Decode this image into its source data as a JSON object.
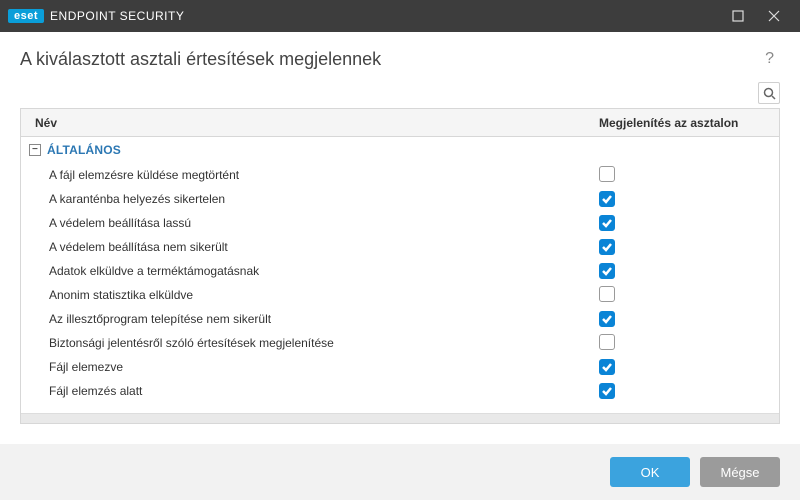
{
  "titlebar": {
    "brand": "eset",
    "product": "ENDPOINT SECURITY"
  },
  "page": {
    "title": "A kiválasztott asztali értesítések megjelennek",
    "help": "?"
  },
  "table": {
    "cols": {
      "name": "Név",
      "show": "Megjelenítés az asztalon"
    },
    "group": "ÁLTALÁNOS",
    "rows": [
      {
        "label": "A fájl elemzésre küldése megtörtént",
        "checked": false
      },
      {
        "label": "A karanténba helyezés sikertelen",
        "checked": true
      },
      {
        "label": "A védelem beállítása lassú",
        "checked": true
      },
      {
        "label": "A védelem beállítása nem sikerült",
        "checked": true
      },
      {
        "label": "Adatok elküldve a terméktámogatásnak",
        "checked": true
      },
      {
        "label": "Anonim statisztika elküldve",
        "checked": false
      },
      {
        "label": "Az illesztőprogram telepítése nem sikerült",
        "checked": true
      },
      {
        "label": "Biztonsági jelentésről szóló értesítések megjelenítése",
        "checked": false
      },
      {
        "label": "Fájl elemezve",
        "checked": true
      },
      {
        "label": "Fájl elemzés alatt",
        "checked": true
      }
    ]
  },
  "footer": {
    "ok": "OK",
    "cancel": "Mégse"
  }
}
